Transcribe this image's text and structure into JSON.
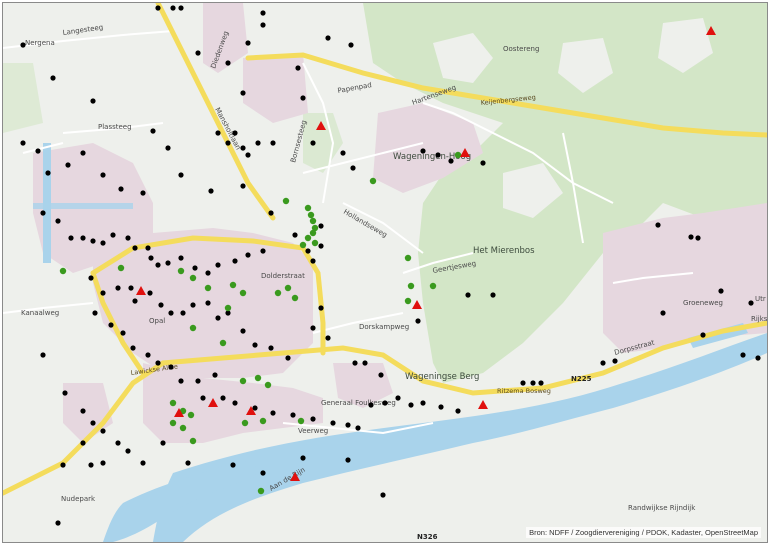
{
  "place_labels": [
    {
      "key": "nergena",
      "text": "Nergena"
    },
    {
      "key": "langesteeg",
      "text": "Langesteeg"
    },
    {
      "key": "oostereng",
      "text": "Oostereng"
    },
    {
      "key": "plassteeg",
      "text": "Plassteeg"
    },
    {
      "key": "papenpad",
      "text": "Papenpad"
    },
    {
      "key": "hartenseweg",
      "text": "Hartenseweg"
    },
    {
      "key": "keijenbergseweg",
      "text": "Keijenbergseweg"
    },
    {
      "key": "wageningen_hoog",
      "text": "Wageningen-Hoog"
    },
    {
      "key": "het_mierenbos",
      "text": "Het Mierenbos"
    },
    {
      "key": "hollandseweg",
      "text": "Hollandseweg"
    },
    {
      "key": "bornsesteeg",
      "text": "Bornsesteeg"
    },
    {
      "key": "dolderstraat",
      "text": "Dolderstraat"
    },
    {
      "key": "ritzema_bosweg",
      "text": "Ritzema Bosweg"
    },
    {
      "key": "wageningse_berg",
      "text": "Wageningse Berg"
    },
    {
      "key": "lawickse_allee",
      "text": "Lawickse Allee"
    },
    {
      "key": "generaal_foulkesweg",
      "text": "Generaal Foulkesweg"
    },
    {
      "key": "n225",
      "text": "N225"
    },
    {
      "key": "nudepark",
      "text": "Nudepark"
    },
    {
      "key": "veerweg",
      "text": "Veerweg"
    },
    {
      "key": "groeneweg",
      "text": "Groeneweg"
    },
    {
      "key": "kanaalweg",
      "text": "Kanaalweg"
    },
    {
      "key": "dorpsstraat",
      "text": "Dorpsstraat"
    },
    {
      "key": "aan_de_rijn",
      "text": "Aan de Rijn"
    },
    {
      "key": "n326",
      "text": "N326"
    },
    {
      "key": "diedenweg",
      "text": "Diedenweg"
    },
    {
      "key": "mansholtlaan",
      "text": "Mansholtlaan"
    },
    {
      "key": "geertjesweg",
      "text": "Geertjesweg"
    },
    {
      "key": "dorskampweg",
      "text": "Dorskampweg"
    },
    {
      "key": "randwijkse_rijndijk",
      "text": "Randwijkse Rijndijk"
    },
    {
      "key": "rijks",
      "text": "Rijks"
    },
    {
      "key": "utr",
      "text": "Utr"
    },
    {
      "key": "opal",
      "text": "Opal"
    }
  ],
  "attribution": "Bron: NDFF / Zoogdiervereniging / PDOK, Kadaster, OpenStreetMap",
  "marker_colors": {
    "black": "#000000",
    "green": "#3a9a1e",
    "red": "#e0100e"
  },
  "map_colors": {
    "forest": "#d3e6c7",
    "urban": "#e6d7df",
    "water": "#a9d3eb",
    "major_road": "#f4dc5c",
    "minor_road": "#ffffff"
  }
}
